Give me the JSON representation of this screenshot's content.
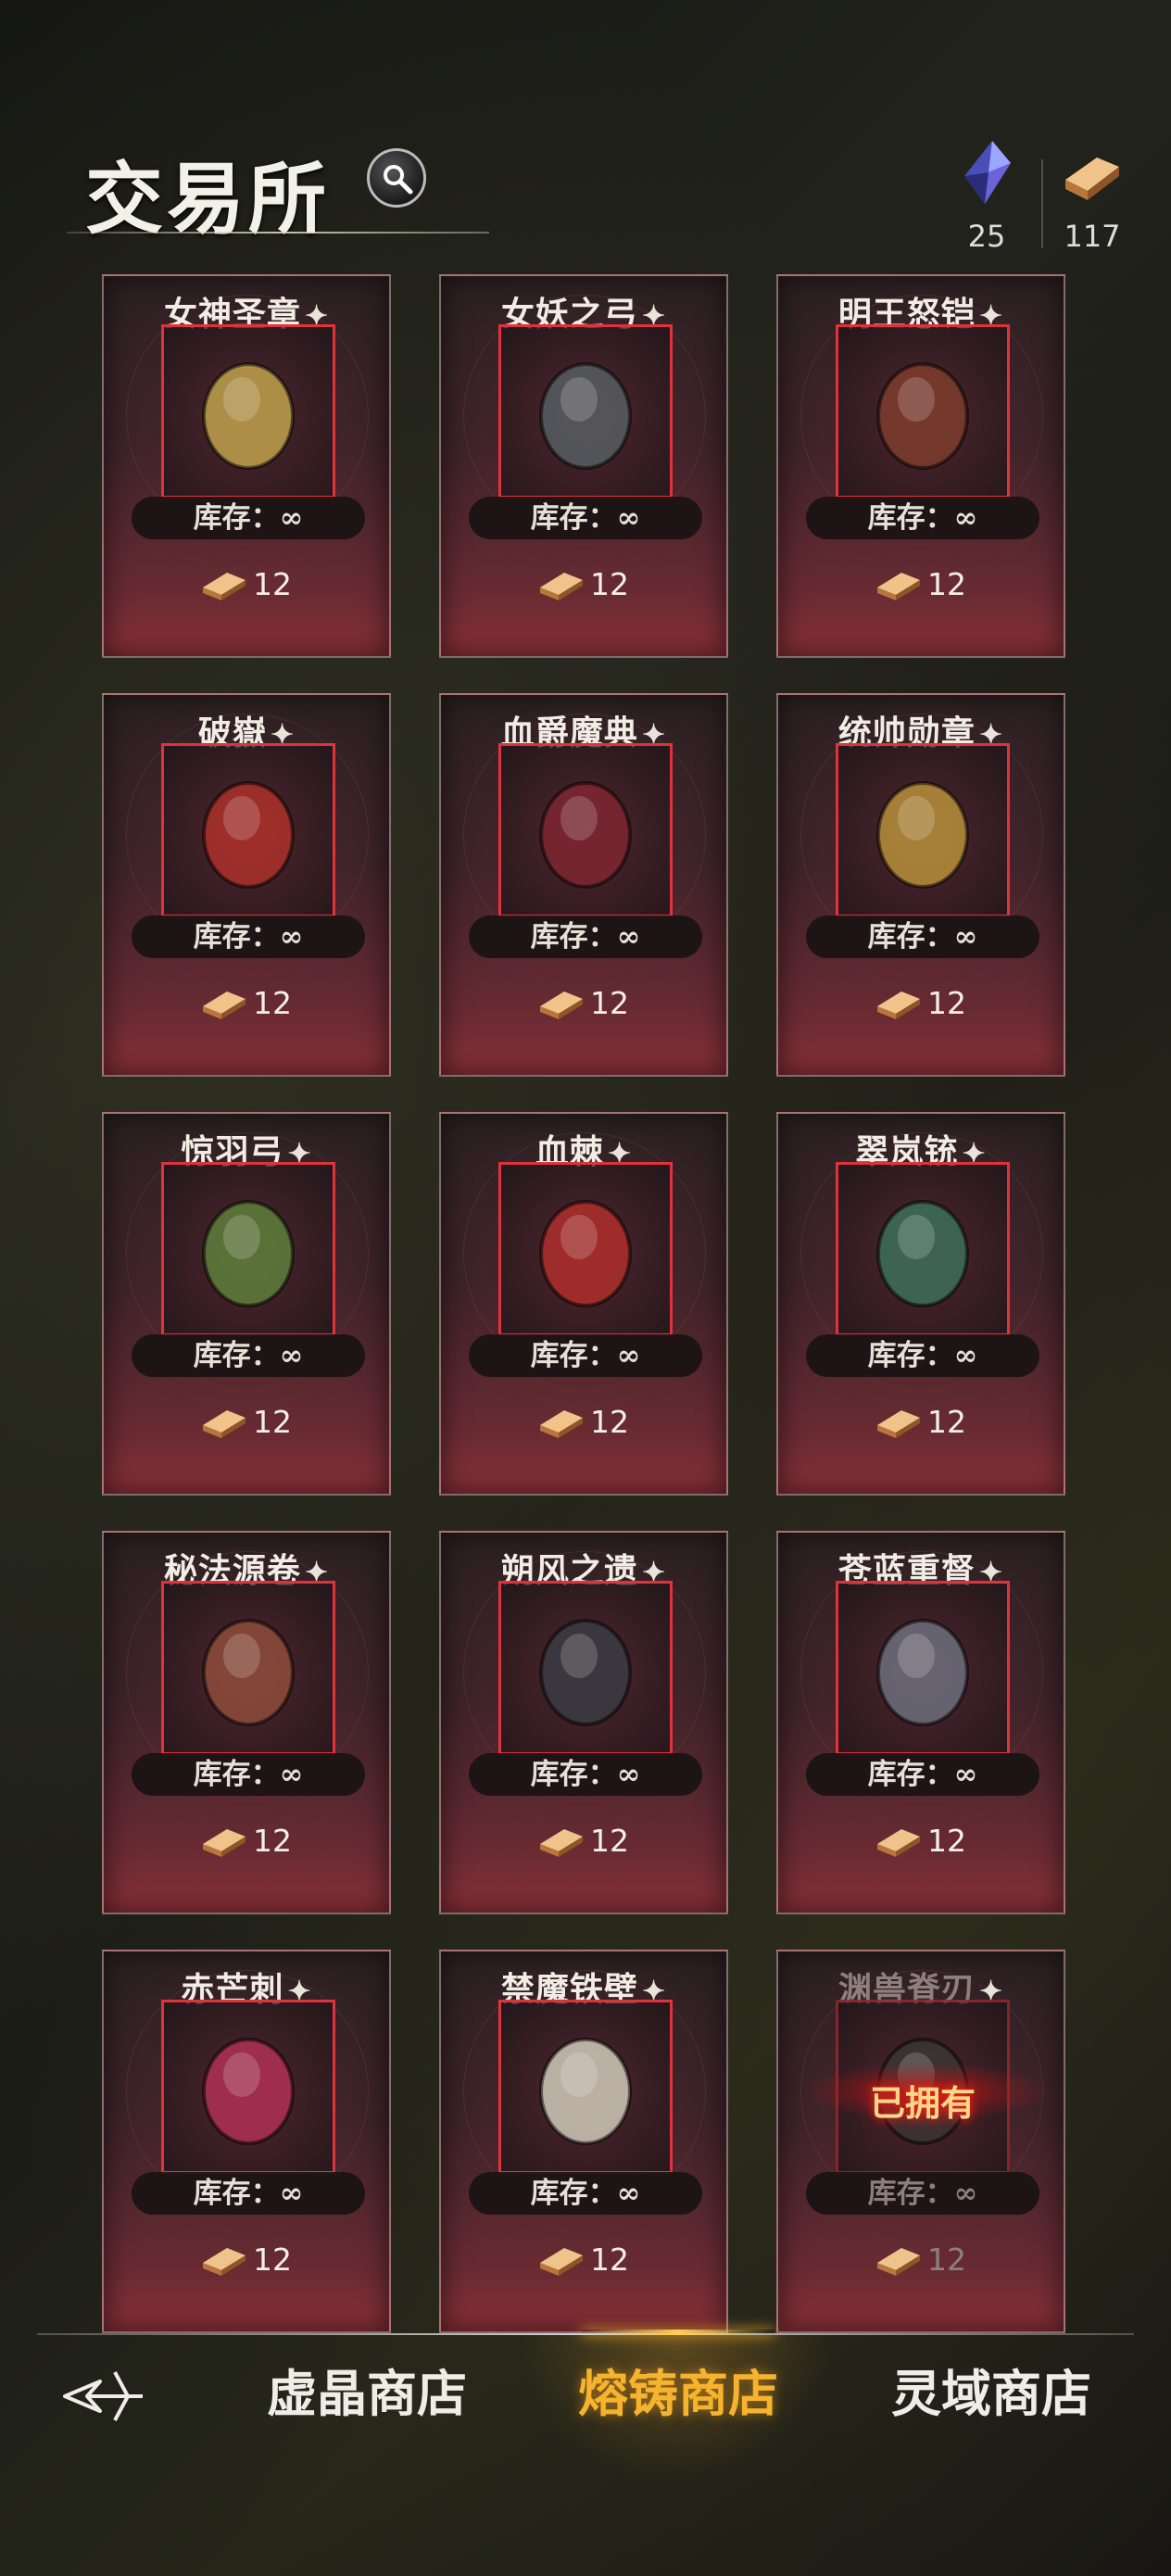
{
  "header": {
    "title": "交易所",
    "currencies": [
      {
        "icon": "purple-crystal-icon",
        "value": "25"
      },
      {
        "icon": "copper-ingot-icon",
        "value": "117"
      }
    ]
  },
  "items": [
    {
      "name": "女神圣章",
      "icon": "golden-tome-icon",
      "stock_label": "库存：∞",
      "price": "12",
      "owned": false
    },
    {
      "name": "女妖之弓",
      "icon": "dark-bow-icon",
      "stock_label": "库存：∞",
      "price": "12",
      "owned": false
    },
    {
      "name": "明王怒铠",
      "icon": "demon-armor-icon",
      "stock_label": "库存：∞",
      "price": "12",
      "owned": false
    },
    {
      "name": "破嶽",
      "icon": "red-axe-icon",
      "stock_label": "库存：∞",
      "price": "12",
      "owned": false
    },
    {
      "name": "血爵魔典",
      "icon": "blood-book-icon",
      "stock_label": "库存：∞",
      "price": "12",
      "owned": false
    },
    {
      "name": "统帅勋章",
      "icon": "medal-icon",
      "stock_label": "库存：∞",
      "price": "12",
      "owned": false
    },
    {
      "name": "惊羽弓",
      "icon": "feather-bow-icon",
      "stock_label": "库存：∞",
      "price": "12",
      "owned": false
    },
    {
      "name": "血棘",
      "icon": "thorn-blade-icon",
      "stock_label": "库存：∞",
      "price": "12",
      "owned": false
    },
    {
      "name": "翠岚铳",
      "icon": "green-pistol-icon",
      "stock_label": "库存：∞",
      "price": "12",
      "owned": false
    },
    {
      "name": "秘法源卷",
      "icon": "scroll-icon",
      "stock_label": "库存：∞",
      "price": "12",
      "owned": false
    },
    {
      "name": "朔风之遗",
      "icon": "fur-cloak-icon",
      "stock_label": "库存：∞",
      "price": "12",
      "owned": false
    },
    {
      "name": "苍蓝重督",
      "icon": "steel-armor-icon",
      "stock_label": "库存：∞",
      "price": "12",
      "owned": false
    },
    {
      "name": "赤芒刺",
      "icon": "crimson-staff-icon",
      "stock_label": "库存：∞",
      "price": "12",
      "owned": false
    },
    {
      "name": "禁魔铁壁",
      "icon": "white-plate-armor-icon",
      "stock_label": "库存：∞",
      "price": "12",
      "owned": false
    },
    {
      "name": "渊兽脊刃",
      "icon": "spine-blade-icon",
      "stock_label": "库存：∞",
      "price": "12",
      "owned": true,
      "owned_label": "已拥有"
    }
  ],
  "nav": {
    "back_icon": "back-arrow-icon",
    "tabs": [
      {
        "label": "虚晶商店",
        "active": false
      },
      {
        "label": "熔铸商店",
        "active": true
      },
      {
        "label": "灵域商店",
        "active": false
      }
    ]
  },
  "colors": {
    "accent_gold": "#f5b32e",
    "frame_red": "#e0323b"
  }
}
